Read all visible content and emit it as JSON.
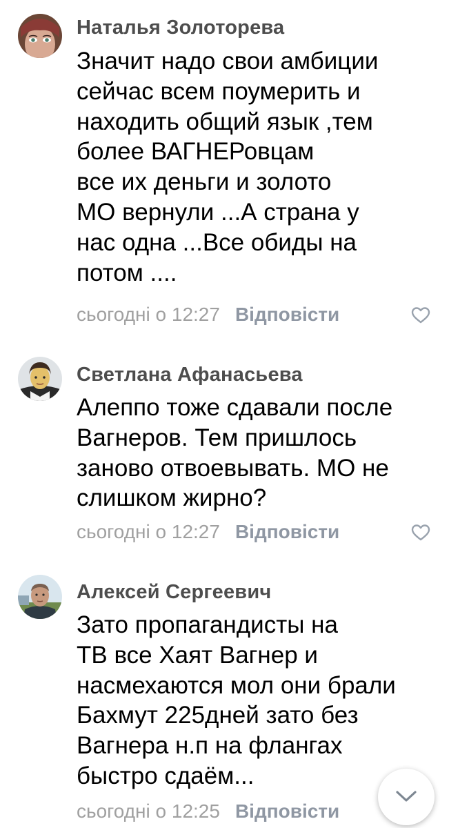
{
  "comments": [
    {
      "author": "Наталья Золоторева",
      "lines": [
        "Значит надо свои амбиции",
        "сейчас всем поумерить и",
        "находить общий язык ,тем",
        "более  ВАГНЕРовцам",
        "все их деньги и золото",
        "МО вернули ...А страна у",
        "нас одна ...Все обиды на",
        "потом ...."
      ],
      "time": "сьогодні о 12:27",
      "reply_label": "Відповісти"
    },
    {
      "author": "Светлана Афанасьева",
      "lines": [
        "Алеппо тоже сдавали после",
        "Вагнеров. Тем пришлось",
        "заново отвоевывать. МО не",
        "слишком жирно?"
      ],
      "time": "сьогодні о 12:27",
      "reply_label": "Відповісти"
    },
    {
      "author": "Алексей Сергеевич",
      "lines": [
        "Зато пропагандисты на",
        "ТВ все Хаят Вагнер и",
        "насмехаются мол они брали",
        "Бахмут 225дней зато без",
        "Вагнера н.п на флангах",
        "быстро сдаём..."
      ],
      "time": "сьогодні о 12:25",
      "reply_label": "Відповісти"
    }
  ],
  "icons": {
    "like": "heart-outline-icon",
    "scroll": "chevron-down-icon"
  },
  "colors": {
    "author": "#4d4d4d",
    "timestamp": "#a0a0a0",
    "reply": "#8f97a3",
    "like_icon": "#99a2ad"
  }
}
